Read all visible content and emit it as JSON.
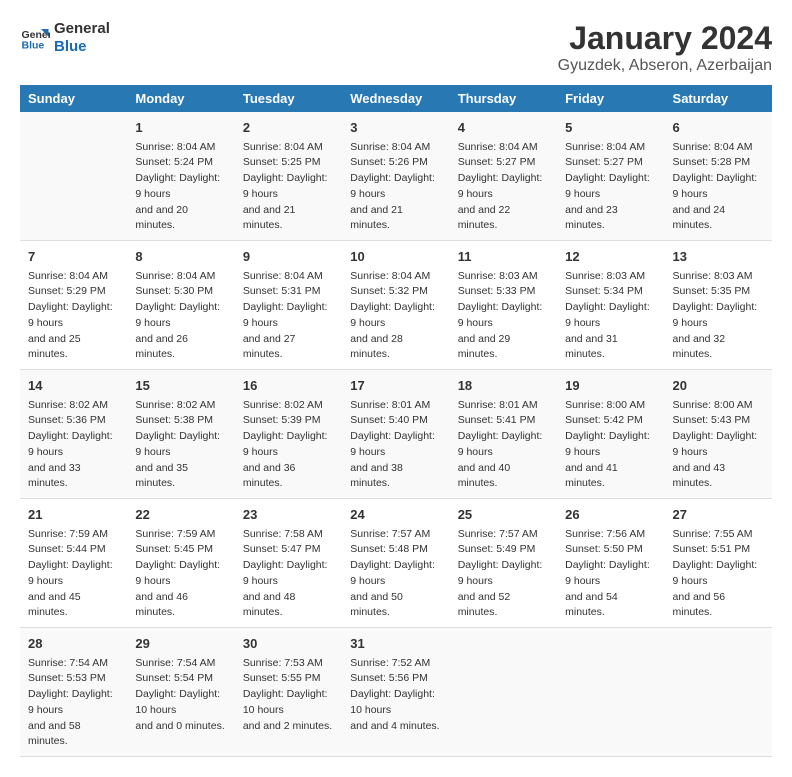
{
  "logo": {
    "line1": "General",
    "line2": "Blue"
  },
  "title": "January 2024",
  "subtitle": "Gyuzdek, Abseron, Azerbaijan",
  "weekdays": [
    "Sunday",
    "Monday",
    "Tuesday",
    "Wednesday",
    "Thursday",
    "Friday",
    "Saturday"
  ],
  "weeks": [
    [
      {
        "day": "",
        "sunrise": "",
        "sunset": "",
        "daylight": ""
      },
      {
        "day": "1",
        "sunrise": "Sunrise: 8:04 AM",
        "sunset": "Sunset: 5:24 PM",
        "daylight": "Daylight: 9 hours and 20 minutes."
      },
      {
        "day": "2",
        "sunrise": "Sunrise: 8:04 AM",
        "sunset": "Sunset: 5:25 PM",
        "daylight": "Daylight: 9 hours and 21 minutes."
      },
      {
        "day": "3",
        "sunrise": "Sunrise: 8:04 AM",
        "sunset": "Sunset: 5:26 PM",
        "daylight": "Daylight: 9 hours and 21 minutes."
      },
      {
        "day": "4",
        "sunrise": "Sunrise: 8:04 AM",
        "sunset": "Sunset: 5:27 PM",
        "daylight": "Daylight: 9 hours and 22 minutes."
      },
      {
        "day": "5",
        "sunrise": "Sunrise: 8:04 AM",
        "sunset": "Sunset: 5:27 PM",
        "daylight": "Daylight: 9 hours and 23 minutes."
      },
      {
        "day": "6",
        "sunrise": "Sunrise: 8:04 AM",
        "sunset": "Sunset: 5:28 PM",
        "daylight": "Daylight: 9 hours and 24 minutes."
      }
    ],
    [
      {
        "day": "7",
        "sunrise": "Sunrise: 8:04 AM",
        "sunset": "Sunset: 5:29 PM",
        "daylight": "Daylight: 9 hours and 25 minutes."
      },
      {
        "day": "8",
        "sunrise": "Sunrise: 8:04 AM",
        "sunset": "Sunset: 5:30 PM",
        "daylight": "Daylight: 9 hours and 26 minutes."
      },
      {
        "day": "9",
        "sunrise": "Sunrise: 8:04 AM",
        "sunset": "Sunset: 5:31 PM",
        "daylight": "Daylight: 9 hours and 27 minutes."
      },
      {
        "day": "10",
        "sunrise": "Sunrise: 8:04 AM",
        "sunset": "Sunset: 5:32 PM",
        "daylight": "Daylight: 9 hours and 28 minutes."
      },
      {
        "day": "11",
        "sunrise": "Sunrise: 8:03 AM",
        "sunset": "Sunset: 5:33 PM",
        "daylight": "Daylight: 9 hours and 29 minutes."
      },
      {
        "day": "12",
        "sunrise": "Sunrise: 8:03 AM",
        "sunset": "Sunset: 5:34 PM",
        "daylight": "Daylight: 9 hours and 31 minutes."
      },
      {
        "day": "13",
        "sunrise": "Sunrise: 8:03 AM",
        "sunset": "Sunset: 5:35 PM",
        "daylight": "Daylight: 9 hours and 32 minutes."
      }
    ],
    [
      {
        "day": "14",
        "sunrise": "Sunrise: 8:02 AM",
        "sunset": "Sunset: 5:36 PM",
        "daylight": "Daylight: 9 hours and 33 minutes."
      },
      {
        "day": "15",
        "sunrise": "Sunrise: 8:02 AM",
        "sunset": "Sunset: 5:38 PM",
        "daylight": "Daylight: 9 hours and 35 minutes."
      },
      {
        "day": "16",
        "sunrise": "Sunrise: 8:02 AM",
        "sunset": "Sunset: 5:39 PM",
        "daylight": "Daylight: 9 hours and 36 minutes."
      },
      {
        "day": "17",
        "sunrise": "Sunrise: 8:01 AM",
        "sunset": "Sunset: 5:40 PM",
        "daylight": "Daylight: 9 hours and 38 minutes."
      },
      {
        "day": "18",
        "sunrise": "Sunrise: 8:01 AM",
        "sunset": "Sunset: 5:41 PM",
        "daylight": "Daylight: 9 hours and 40 minutes."
      },
      {
        "day": "19",
        "sunrise": "Sunrise: 8:00 AM",
        "sunset": "Sunset: 5:42 PM",
        "daylight": "Daylight: 9 hours and 41 minutes."
      },
      {
        "day": "20",
        "sunrise": "Sunrise: 8:00 AM",
        "sunset": "Sunset: 5:43 PM",
        "daylight": "Daylight: 9 hours and 43 minutes."
      }
    ],
    [
      {
        "day": "21",
        "sunrise": "Sunrise: 7:59 AM",
        "sunset": "Sunset: 5:44 PM",
        "daylight": "Daylight: 9 hours and 45 minutes."
      },
      {
        "day": "22",
        "sunrise": "Sunrise: 7:59 AM",
        "sunset": "Sunset: 5:45 PM",
        "daylight": "Daylight: 9 hours and 46 minutes."
      },
      {
        "day": "23",
        "sunrise": "Sunrise: 7:58 AM",
        "sunset": "Sunset: 5:47 PM",
        "daylight": "Daylight: 9 hours and 48 minutes."
      },
      {
        "day": "24",
        "sunrise": "Sunrise: 7:57 AM",
        "sunset": "Sunset: 5:48 PM",
        "daylight": "Daylight: 9 hours and 50 minutes."
      },
      {
        "day": "25",
        "sunrise": "Sunrise: 7:57 AM",
        "sunset": "Sunset: 5:49 PM",
        "daylight": "Daylight: 9 hours and 52 minutes."
      },
      {
        "day": "26",
        "sunrise": "Sunrise: 7:56 AM",
        "sunset": "Sunset: 5:50 PM",
        "daylight": "Daylight: 9 hours and 54 minutes."
      },
      {
        "day": "27",
        "sunrise": "Sunrise: 7:55 AM",
        "sunset": "Sunset: 5:51 PM",
        "daylight": "Daylight: 9 hours and 56 minutes."
      }
    ],
    [
      {
        "day": "28",
        "sunrise": "Sunrise: 7:54 AM",
        "sunset": "Sunset: 5:53 PM",
        "daylight": "Daylight: 9 hours and 58 minutes."
      },
      {
        "day": "29",
        "sunrise": "Sunrise: 7:54 AM",
        "sunset": "Sunset: 5:54 PM",
        "daylight": "Daylight: 10 hours and 0 minutes."
      },
      {
        "day": "30",
        "sunrise": "Sunrise: 7:53 AM",
        "sunset": "Sunset: 5:55 PM",
        "daylight": "Daylight: 10 hours and 2 minutes."
      },
      {
        "day": "31",
        "sunrise": "Sunrise: 7:52 AM",
        "sunset": "Sunset: 5:56 PM",
        "daylight": "Daylight: 10 hours and 4 minutes."
      },
      {
        "day": "",
        "sunrise": "",
        "sunset": "",
        "daylight": ""
      },
      {
        "day": "",
        "sunrise": "",
        "sunset": "",
        "daylight": ""
      },
      {
        "day": "",
        "sunrise": "",
        "sunset": "",
        "daylight": ""
      }
    ]
  ]
}
